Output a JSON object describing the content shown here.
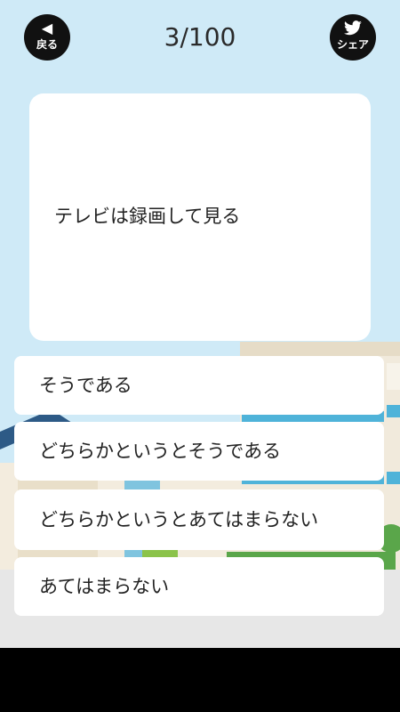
{
  "header": {
    "back_label": "戻る",
    "back_icon": "triangle-left",
    "progress": "3/100",
    "share_label": "シェア",
    "share_icon": "twitter-bird"
  },
  "question": {
    "text": "テレビは録画して見る"
  },
  "answers": [
    {
      "label": "そうである"
    },
    {
      "label": "どちらかというとそうである"
    },
    {
      "label": "どちらかというとあてはまらない"
    },
    {
      "label": "あてはまらない"
    }
  ],
  "colors": {
    "sky": "#cfeaf7",
    "button_dark": "#111111",
    "card": "#ffffff",
    "house_roof": "#2d5a86",
    "building_stripe": "#4fb3d9",
    "bush": "#5aa64a"
  }
}
